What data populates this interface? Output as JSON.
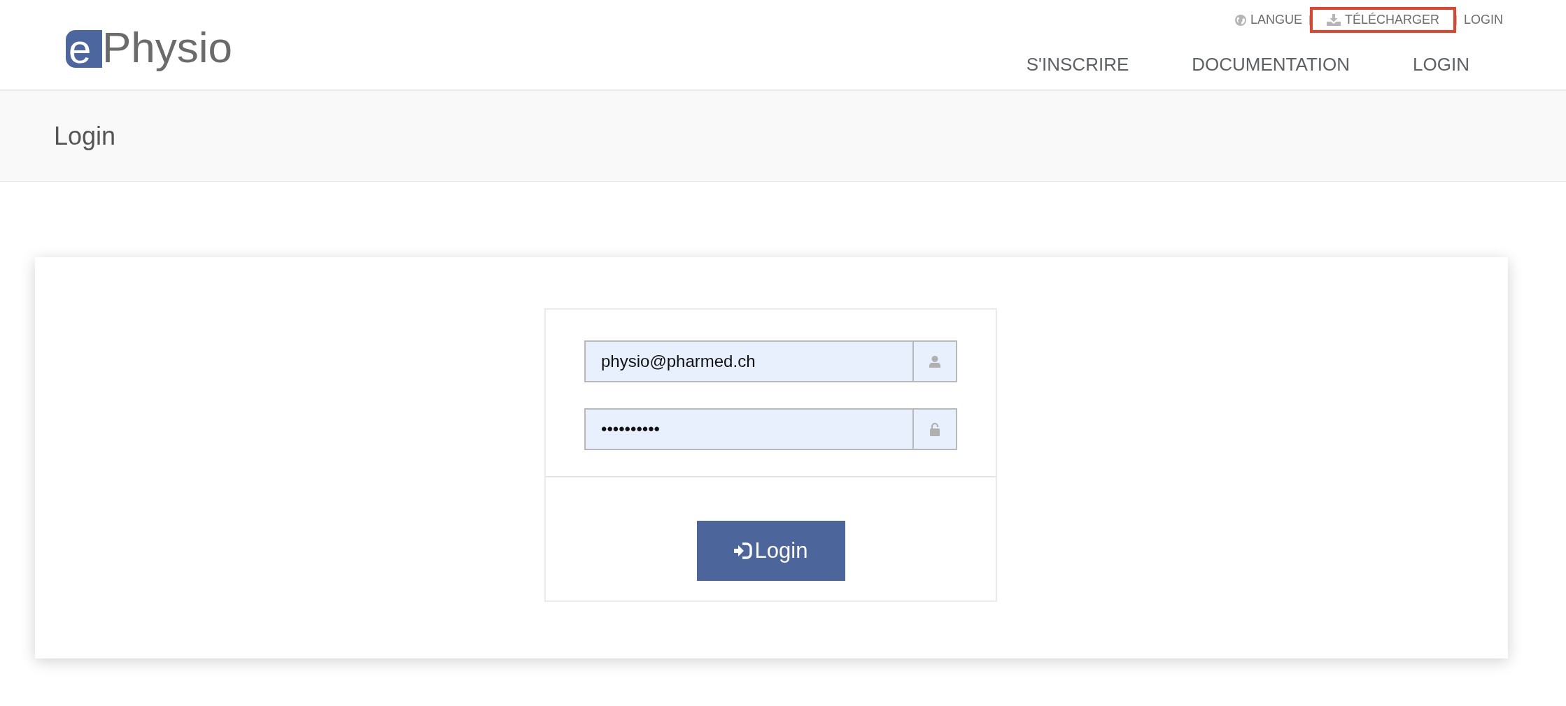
{
  "logo": {
    "letter": "e",
    "text": "Physio"
  },
  "top_links": [
    {
      "label": "LANGUE",
      "kind": "language",
      "highlighted": false
    },
    {
      "label": "TÉLÉCHARGER",
      "kind": "download",
      "highlighted": true
    },
    {
      "label": "LOGIN",
      "kind": "login",
      "highlighted": false
    }
  ],
  "nav": [
    "S'INSCRIRE",
    "DOCUMENTATION",
    "LOGIN"
  ],
  "page_title": "Login",
  "form": {
    "fields": [
      {
        "kind": "email",
        "value": "physio@pharmed.ch"
      },
      {
        "kind": "password",
        "value": "••••••••••"
      }
    ],
    "submit": "Login"
  }
}
